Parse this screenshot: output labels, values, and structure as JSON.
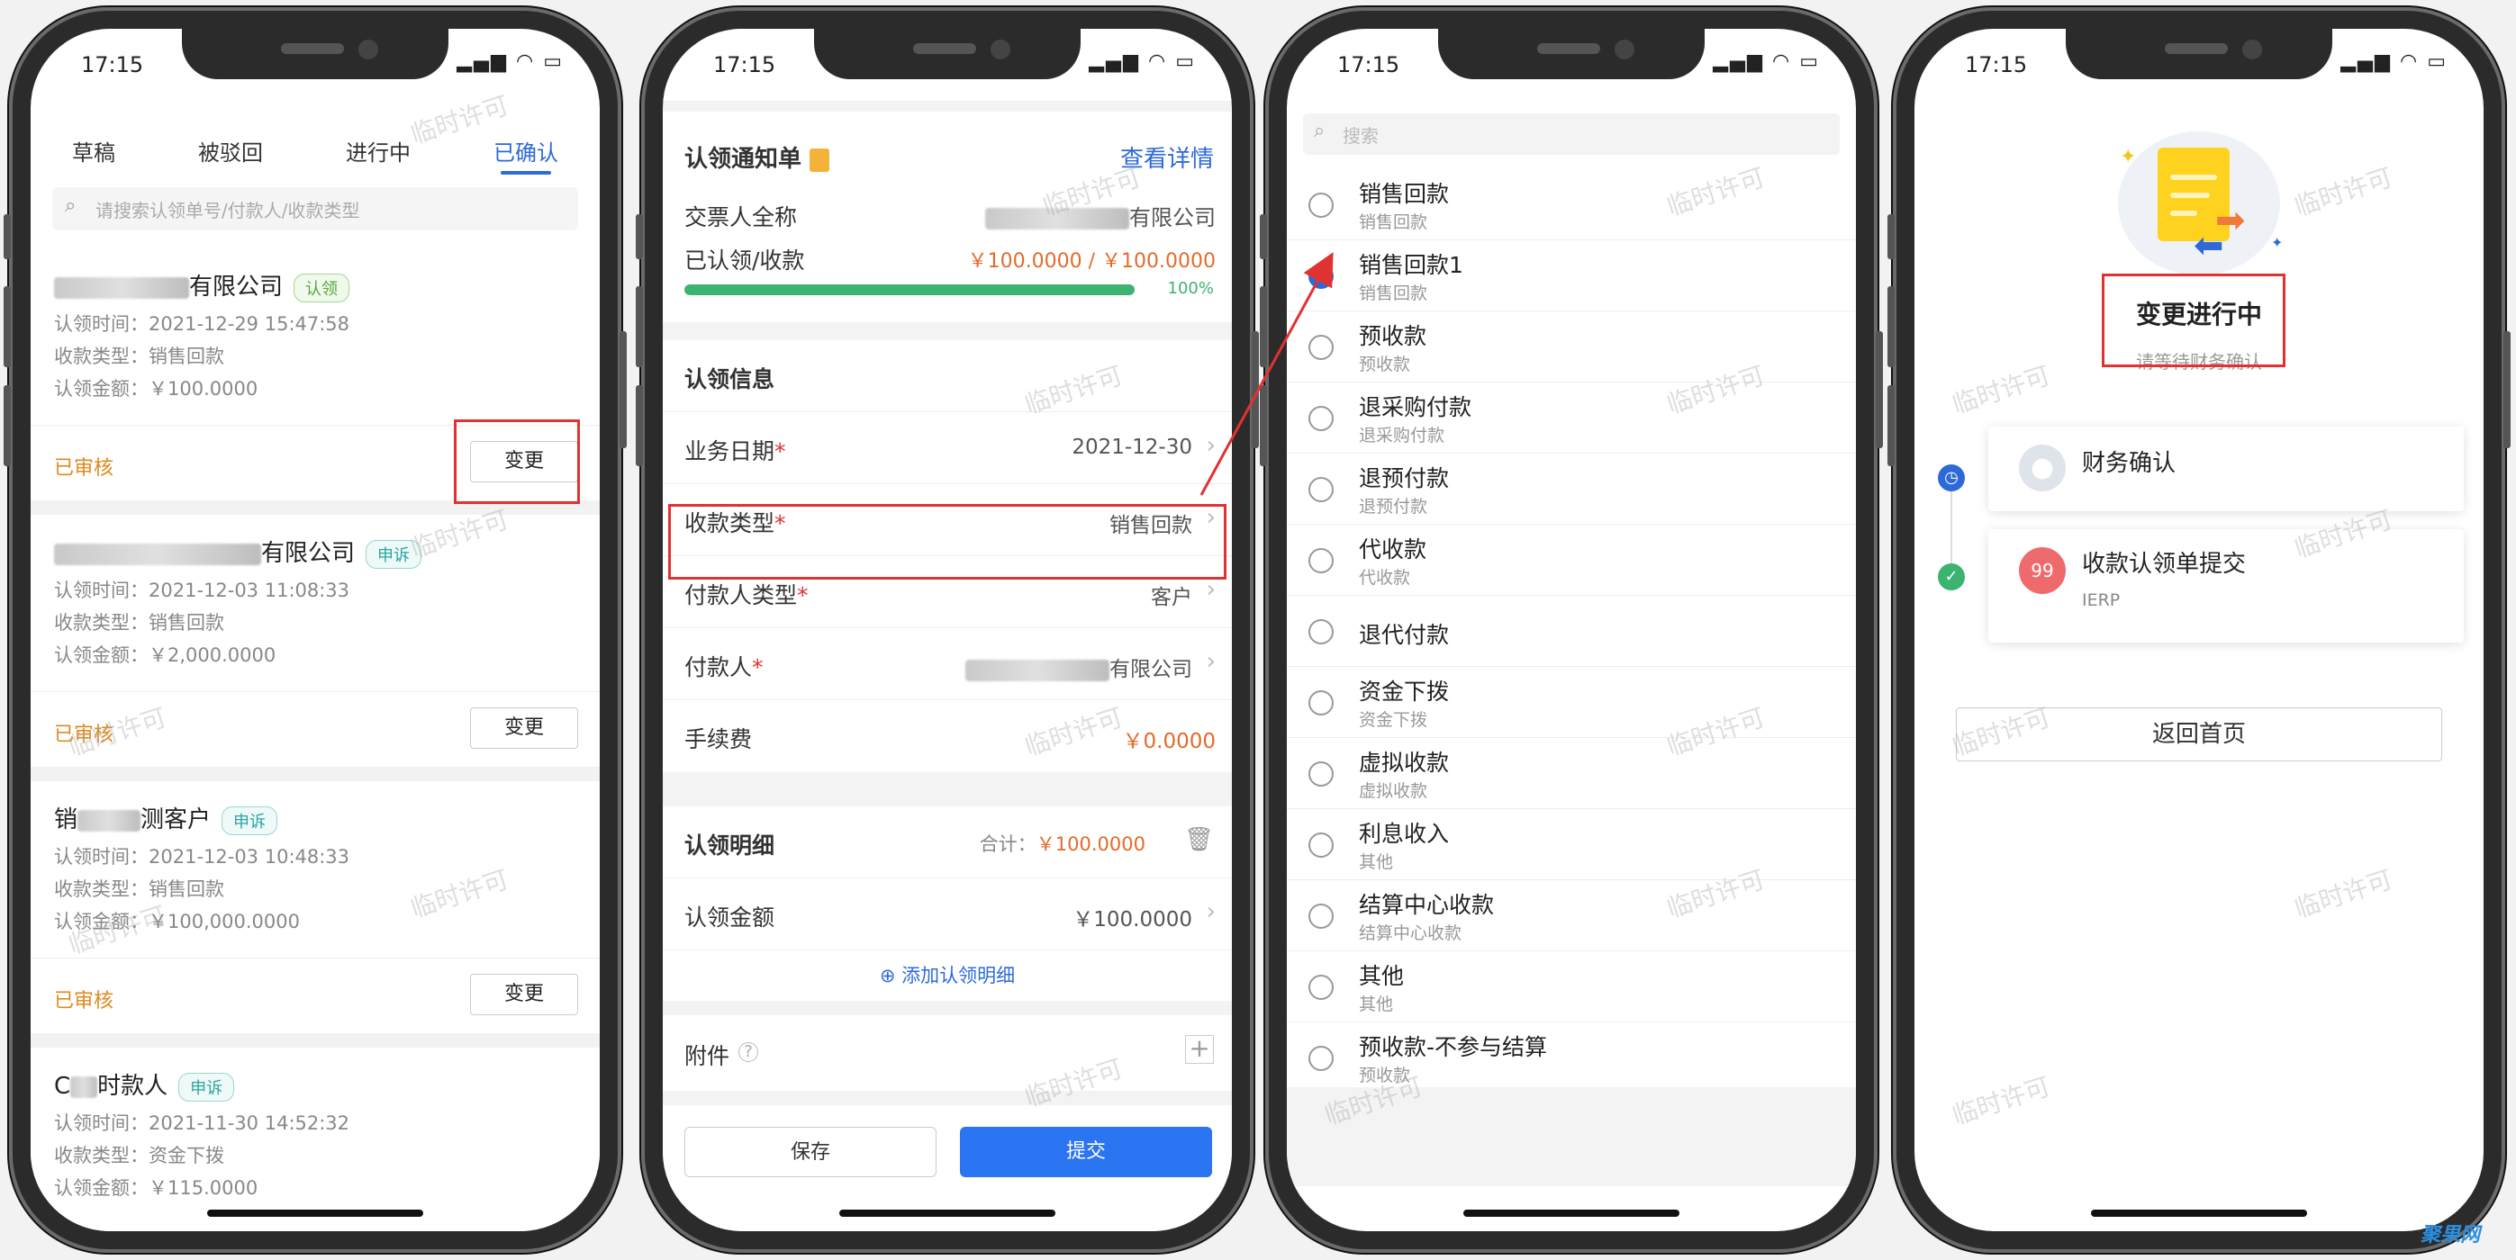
{
  "status": {
    "time": "17:15",
    "icons": "▂▄▆ ◠ ▭"
  },
  "watermark": "临时许可",
  "phone1": {
    "tabs": [
      "草稿",
      "被驳回",
      "进行中",
      "已确认"
    ],
    "search_placeholder": "请搜索认领单号/付款人/收款类型",
    "cards": [
      {
        "name_suffix": "有限公司",
        "tag": "认领",
        "time": "认领时间：2021-12-29 15:47:58",
        "type": "收款类型：销售回款",
        "amount": "认领金额：￥100.0000",
        "status": "已审核",
        "button": "变更"
      },
      {
        "name_suffix": "有限公司",
        "tag": "申诉",
        "time": "认领时间：2021-12-03 11:08:33",
        "type": "收款类型：销售回款",
        "amount": "认领金额：￥2,000.0000",
        "status": "已审核",
        "button": "变更"
      },
      {
        "name_prefix": "销",
        "name_suffix": "测客户",
        "tag": "申诉",
        "time": "认领时间：2021-12-03 10:48:33",
        "type": "收款类型：销售回款",
        "amount": "认领金额：￥100,000.0000",
        "status": "已审核",
        "button": "变更"
      },
      {
        "name_prefix": "C",
        "name_suffix": "时款人",
        "tag": "申诉",
        "time": "认领时间：2021-11-30 14:52:32",
        "type": "收款类型：资金下拨",
        "amount": "认领金额：￥115.0000"
      }
    ]
  },
  "phone2": {
    "notice_title": "认领通知单",
    "view_detail": "查看详情",
    "payer_label": "交票人全称",
    "payer_suffix": "有限公司",
    "claimed_label": "已认领/收款",
    "claimed_value": "￥100.0000 / ￥100.0000",
    "progress": "100%",
    "progress_fraction": 1.0,
    "info_title": "认领信息",
    "biz_date_label": "业务日期",
    "biz_date": "2021-12-30",
    "collect_type_label": "收款类型",
    "collect_type": "销售回款",
    "payer_type_label": "付款人类型",
    "payer_type": "客户",
    "payer_person_label": "付款人",
    "payer_person_suffix": "有限公司",
    "fee_label": "手续费",
    "fee": "￥0.0000",
    "detail_title": "认领明细",
    "total_label": "合计：",
    "total": "￥100.0000",
    "claim_amount_label": "认领金额",
    "claim_amount": "￥100.0000",
    "add_detail": "添加认领明细",
    "attach_label": "附件",
    "save": "保存",
    "submit": "提交"
  },
  "phone3": {
    "search_placeholder": "搜索",
    "options": [
      {
        "title": "销售回款",
        "sub": "销售回款",
        "checked": false
      },
      {
        "title": "销售回款1",
        "sub": "销售回款",
        "checked": true
      },
      {
        "title": "预收款",
        "sub": "预收款",
        "checked": false
      },
      {
        "title": "退采购付款",
        "sub": "退采购付款",
        "checked": false
      },
      {
        "title": "退预付款",
        "sub": "退预付款",
        "checked": false
      },
      {
        "title": "代收款",
        "sub": "代收款",
        "checked": false
      },
      {
        "title": "退代付款",
        "sub": "",
        "checked": false
      },
      {
        "title": "资金下拨",
        "sub": "资金下拨",
        "checked": false
      },
      {
        "title": "虚拟收款",
        "sub": "虚拟收款",
        "checked": false
      },
      {
        "title": "利息收入",
        "sub": "其他",
        "checked": false
      },
      {
        "title": "结算中心收款",
        "sub": "结算中心收款",
        "checked": false
      },
      {
        "title": "其他",
        "sub": "其他",
        "checked": false
      },
      {
        "title": "预收款-不参与结算",
        "sub": "预收款",
        "checked": false
      }
    ]
  },
  "phone4": {
    "heading": "变更进行中",
    "subheading": "请等待财务确认",
    "step1_title": "财务确认",
    "step2_badge": "99",
    "step2_title": "收款认领单提交",
    "step2_sub": "IERP",
    "back_button": "返回首页"
  },
  "logo": "聚果网",
  "colors": {
    "accent": "#2d6ad8",
    "orange": "#e26c2c",
    "status": "#e08a1e",
    "highlight": "#e13232",
    "progress": "#3cb370"
  }
}
